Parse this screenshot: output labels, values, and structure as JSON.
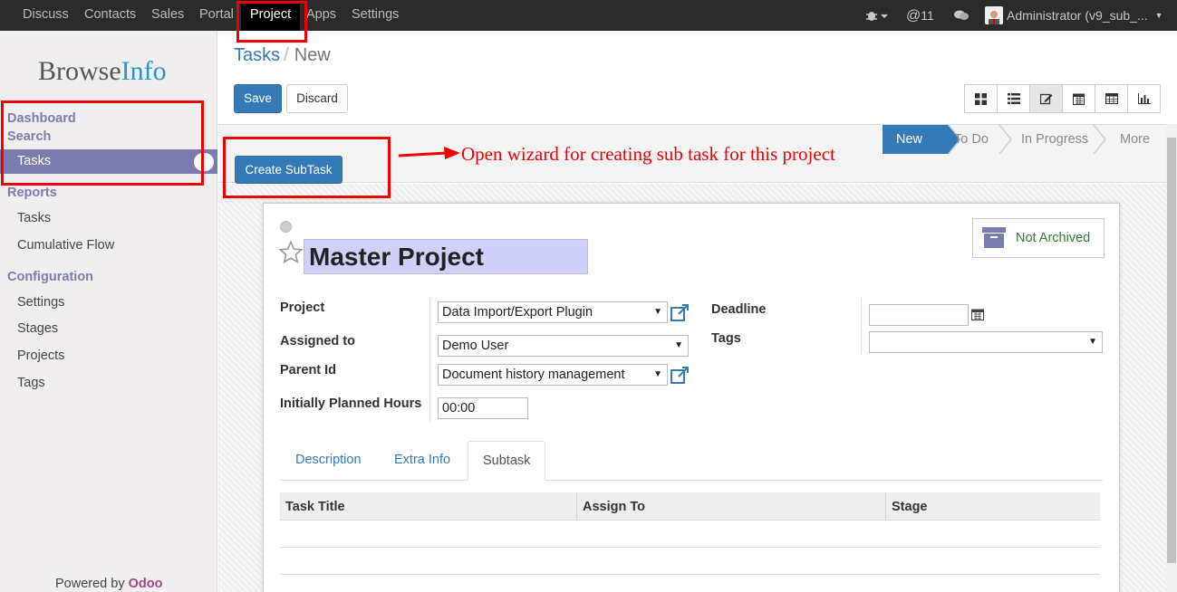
{
  "topbar": {
    "menu": [
      "Discuss",
      "Contacts",
      "Sales",
      "Portal",
      "Project",
      "Apps",
      "Settings"
    ],
    "active_menu": "Project",
    "bug_icon": "bug-icon",
    "messages_count": "11",
    "user": "Administrator (v9_sub_..."
  },
  "sidebar": {
    "logo_browse": "Browse",
    "logo_info": "Info",
    "sections": [
      {
        "title": "Dashboard",
        "items": []
      },
      {
        "title": "Search",
        "items": [
          "Tasks"
        ]
      },
      {
        "title": "Reports",
        "items": [
          "Tasks",
          "Cumulative Flow"
        ]
      },
      {
        "title": "Configuration",
        "items": [
          "Settings",
          "Stages",
          "Projects",
          "Tags"
        ]
      }
    ],
    "active_item": "Tasks",
    "powered_by": "Powered by",
    "powered_brand": "Odoo"
  },
  "breadcrumb": {
    "parent": "Tasks",
    "separator": "/",
    "current": "New"
  },
  "buttons": {
    "save": "Save",
    "discard": "Discard",
    "create_subtask": "Create SubTask"
  },
  "views": [
    "kanban-icon",
    "list-icon",
    "form-icon",
    "calendar-icon",
    "pivot-icon",
    "graph-icon"
  ],
  "active_view": "form-icon",
  "stages": [
    "New",
    "To Do",
    "In Progress",
    "More"
  ],
  "current_stage": "New",
  "annotation": "Open wizard for creating sub task for this project",
  "form": {
    "title": "Master Project",
    "archive_button": "Not Archived",
    "fields": {
      "project_label": "Project",
      "project_value": "Data Import/Export Plugin",
      "assigned_label": "Assigned to",
      "assigned_value": "Demo User",
      "parent_label": "Parent Id",
      "parent_value": "Document history management",
      "hours_label": "Initially Planned Hours",
      "hours_value": "00:00",
      "deadline_label": "Deadline",
      "deadline_value": "",
      "tags_label": "Tags",
      "tags_value": ""
    },
    "tabs": [
      "Description",
      "Extra Info",
      "Subtask"
    ],
    "active_tab": "Subtask",
    "subtask_columns": [
      "Task Title",
      "Assign To",
      "Stage"
    ],
    "subtask_rows": []
  },
  "colors": {
    "primary": "#337ab7",
    "sidebar_accent": "#7c7bad",
    "annotation_red": "#e00000",
    "odoo_purple": "#a24689"
  }
}
